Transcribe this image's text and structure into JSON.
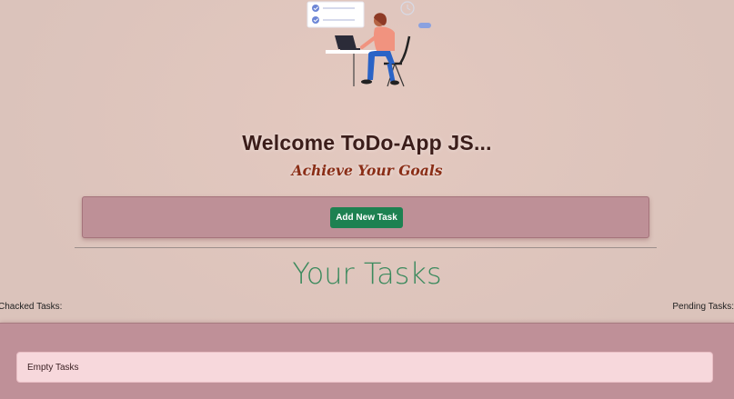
{
  "header": {
    "title": "Welcome ToDo-App JS...",
    "subtitle": "Achieve Your Goals",
    "illustration": "person-working-at-laptop-illustration"
  },
  "add_panel": {
    "add_button_label": "Add New Task"
  },
  "tasks": {
    "heading": "Your Tasks",
    "checked_label": "Chacked Tasks:",
    "pending_label": "Pending Tasks:",
    "empty_message": "Empty Tasks"
  },
  "colors": {
    "background": "#dbc3bb",
    "panel": "#be9097",
    "accent_button": "#1d8151",
    "heading_green": "#3b8a5d",
    "subtitle_rust": "#8a2d16",
    "empty_card": "#f7d8dc"
  }
}
